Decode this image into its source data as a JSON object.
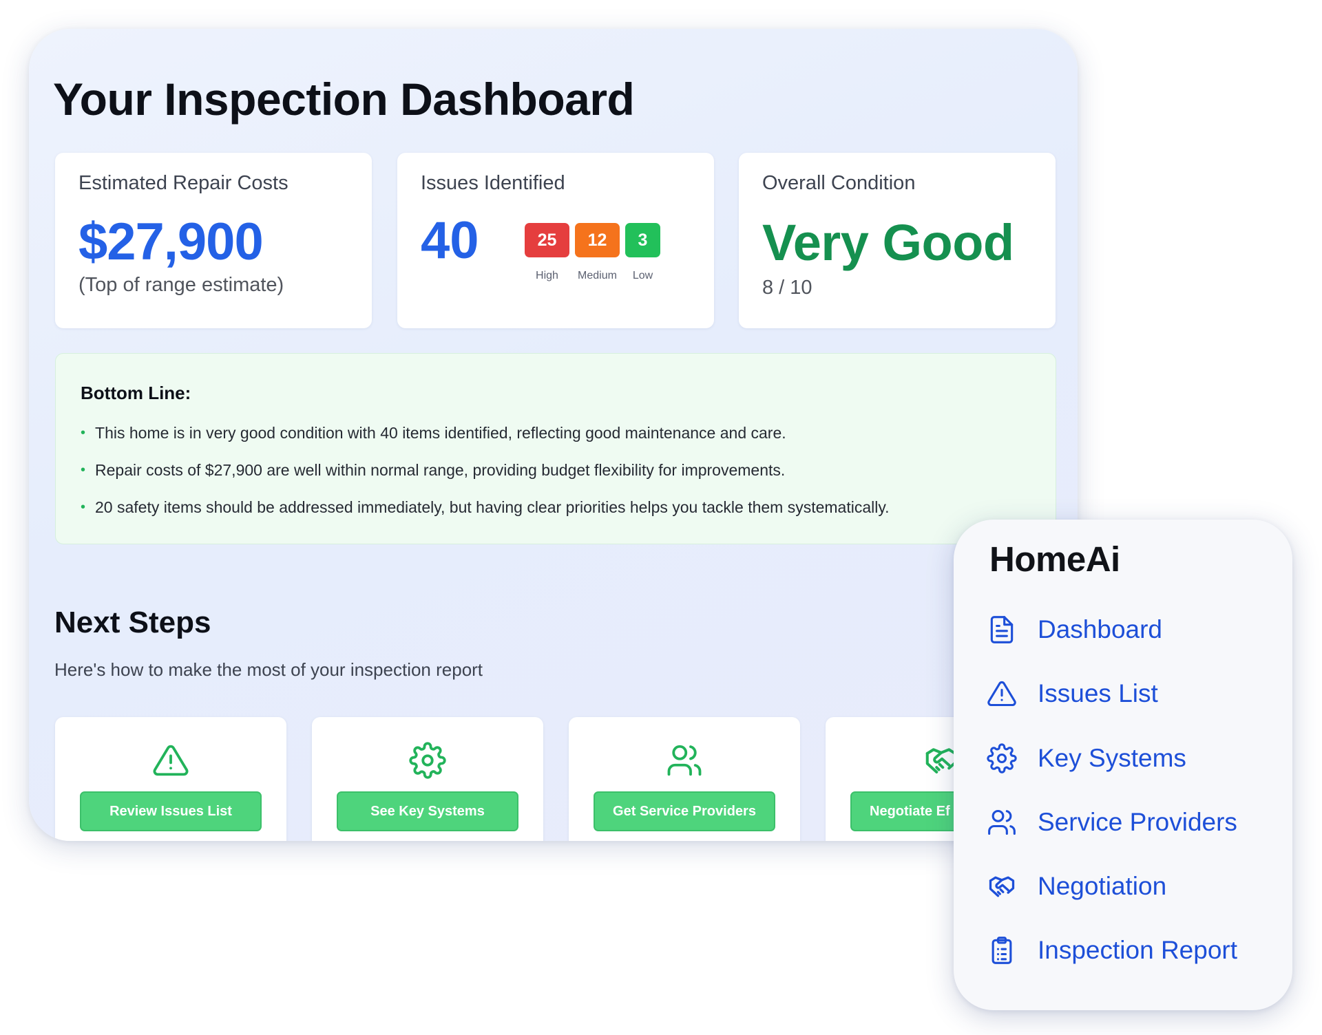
{
  "dashboard": {
    "title": "Your Inspection Dashboard",
    "cards": {
      "repair": {
        "label": "Estimated Repair Costs",
        "value": "$27,900",
        "note": "(Top of range estimate)"
      },
      "issues": {
        "label": "Issues Identified",
        "value": "40",
        "badges": [
          {
            "count": "25",
            "label": "High",
            "color": "#e53e3e"
          },
          {
            "count": "12",
            "label": "Medium",
            "color": "#f5731c"
          },
          {
            "count": "3",
            "label": "Low",
            "color": "#22c05a"
          }
        ]
      },
      "condition": {
        "label": "Overall Condition",
        "value": "Very Good",
        "score": "8 / 10"
      }
    },
    "bottom_line": {
      "title": "Bottom Line:",
      "items": [
        "This home is in very good condition with 40 items identified, reflecting good maintenance and care.",
        "Repair costs of $27,900 are well within normal range, providing budget flexibility for improvements.",
        "20 safety items should be addressed immediately, but having clear priorities helps you tackle them systematically."
      ]
    },
    "next_steps": {
      "title": "Next Steps",
      "subtitle": "Here's how to make the most of your inspection report",
      "steps": [
        {
          "icon": "warning-icon",
          "button": "Review Issues List"
        },
        {
          "icon": "gear-icon",
          "button": "See Key Systems"
        },
        {
          "icon": "users-icon",
          "button": "Get Service Providers"
        },
        {
          "icon": "handshake-icon",
          "button": "Negotiate Ef"
        }
      ]
    }
  },
  "nav": {
    "title": "HomeAi",
    "items": [
      {
        "icon": "document-icon",
        "label": "Dashboard"
      },
      {
        "icon": "warning-icon",
        "label": "Issues List"
      },
      {
        "icon": "gear-icon",
        "label": "Key Systems"
      },
      {
        "icon": "users-icon",
        "label": "Service Providers"
      },
      {
        "icon": "handshake-icon",
        "label": "Negotiation"
      },
      {
        "icon": "clipboard-icon",
        "label": "Inspection Report"
      }
    ]
  },
  "colors": {
    "accent_blue": "#2461e6",
    "nav_blue": "#1d4fd8",
    "good_green": "#15904f",
    "button_green": "#4ed47c"
  }
}
